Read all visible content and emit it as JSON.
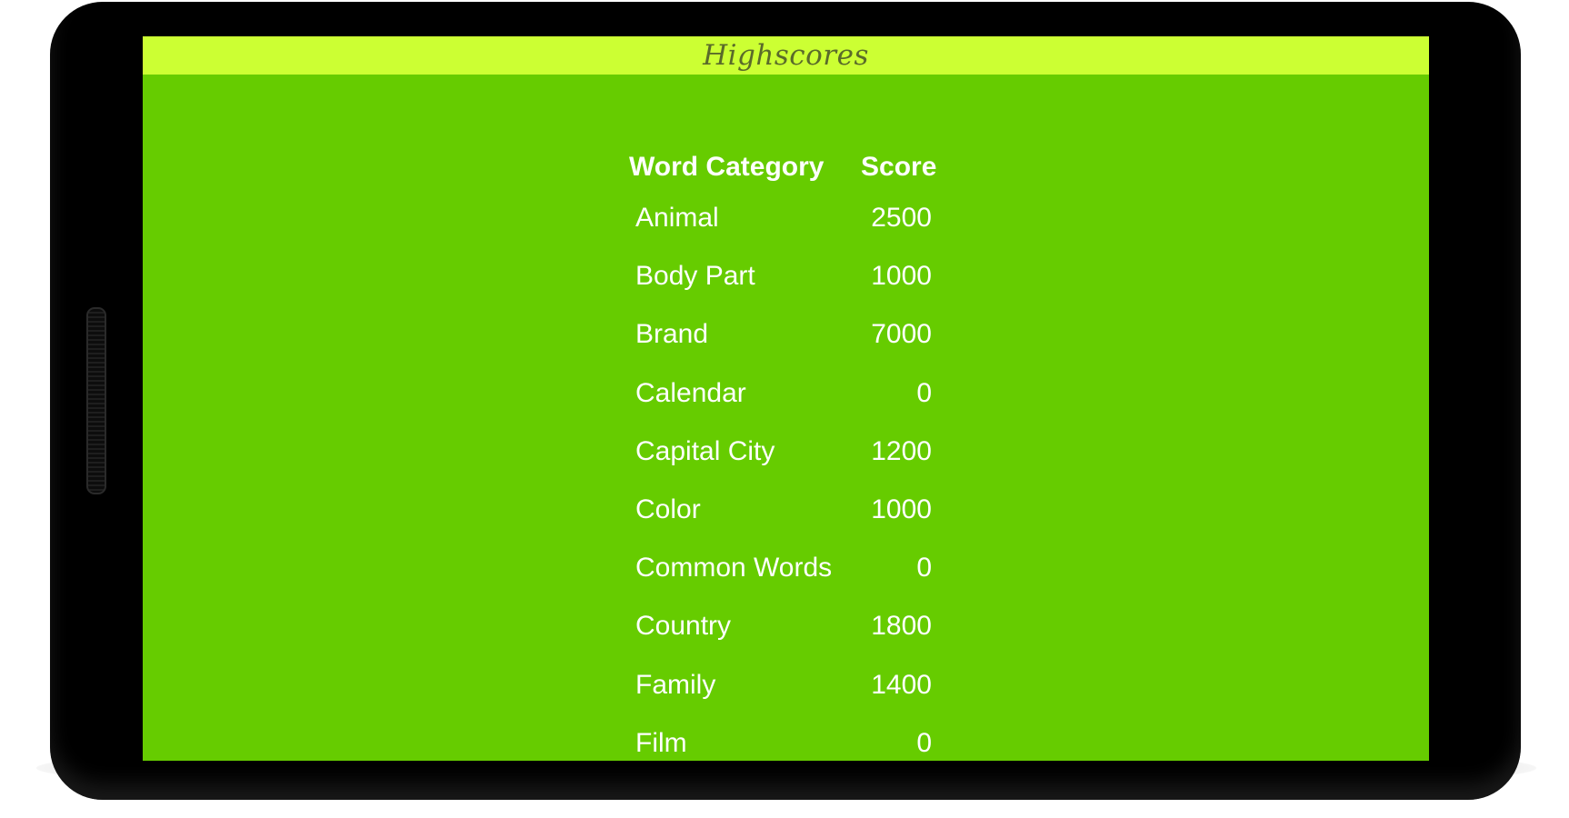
{
  "app": {
    "title": "Highscores"
  },
  "colors": {
    "screen_background": "#66cc00",
    "title_bar": "#ccff33",
    "text": "#ffffff",
    "device_frame": "#000000"
  },
  "table": {
    "headers": {
      "category": "Word Category",
      "score": "Score"
    },
    "rows": [
      {
        "category": "Animal",
        "score": "2500"
      },
      {
        "category": "Body Part",
        "score": "1000"
      },
      {
        "category": "Brand",
        "score": "7000"
      },
      {
        "category": "Calendar",
        "score": "0"
      },
      {
        "category": "Capital City",
        "score": "1200"
      },
      {
        "category": "Color",
        "score": "1000"
      },
      {
        "category": "Common Words",
        "score": "0"
      },
      {
        "category": "Country",
        "score": "1800"
      },
      {
        "category": "Family",
        "score": "1400"
      },
      {
        "category": "Film",
        "score": "0"
      }
    ]
  }
}
